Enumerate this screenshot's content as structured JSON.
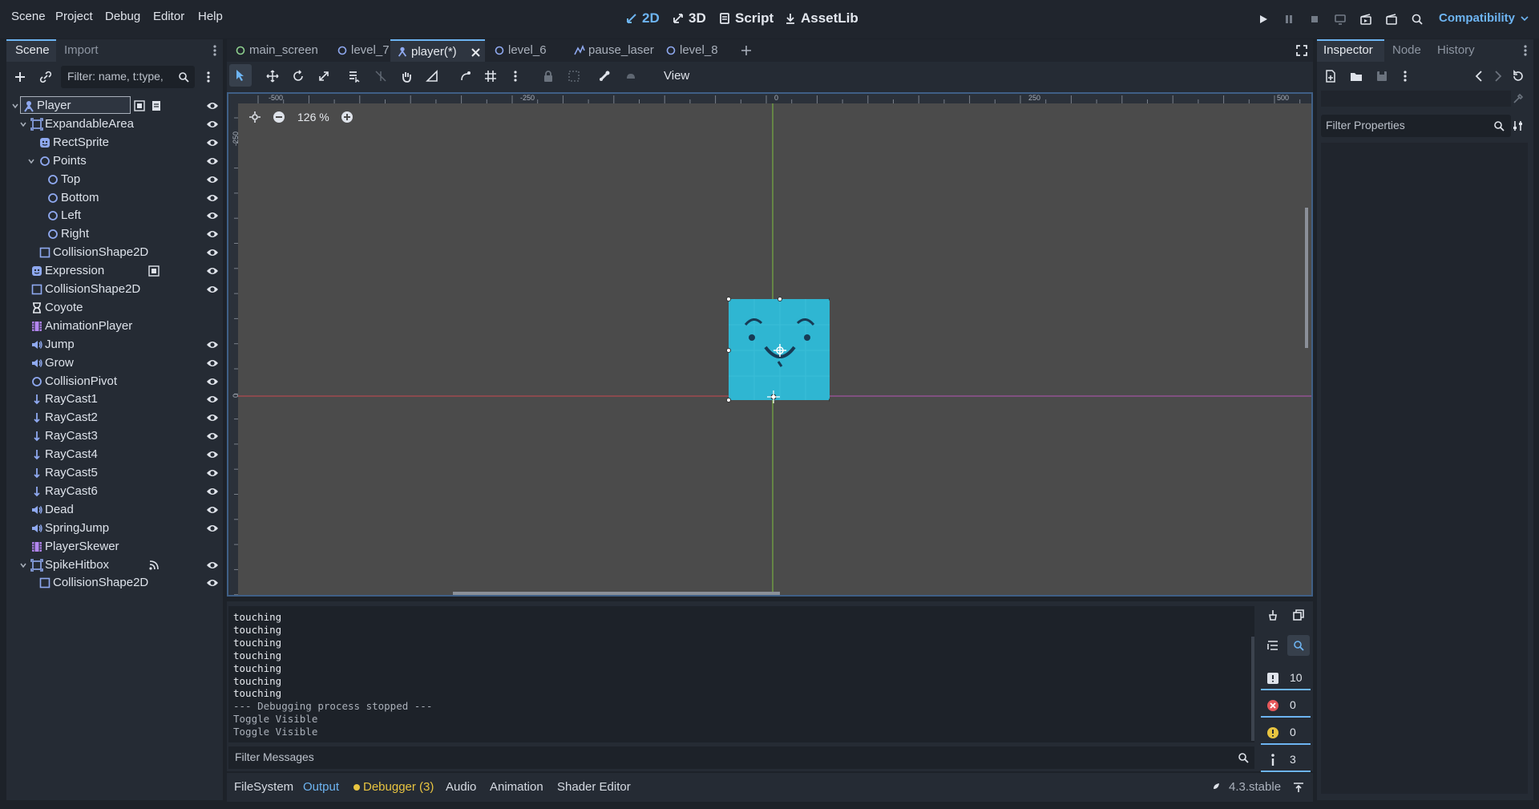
{
  "menubar": {
    "items": [
      "Scene",
      "Project",
      "Debug",
      "Editor",
      "Help"
    ],
    "workspaces": [
      "2D",
      "3D",
      "Script",
      "AssetLib"
    ],
    "active_workspace": "2D",
    "renderer": "Compatibility"
  },
  "scene_dock": {
    "tabs": [
      "Scene",
      "Import"
    ],
    "filter_placeholder": "Filter: name, t:type,",
    "nodes": [
      {
        "name": "Player",
        "icon": "player-node-icon",
        "depth": 0,
        "expanded": true,
        "selected": true
      },
      {
        "name": "ExpandableArea",
        "icon": "area2d-icon",
        "depth": 1,
        "expanded": true
      },
      {
        "name": "RectSprite",
        "icon": "sprite-icon",
        "depth": 2
      },
      {
        "name": "Points",
        "icon": "node2d-icon",
        "depth": 2,
        "expanded": true
      },
      {
        "name": "Top",
        "icon": "node2d-icon",
        "depth": 3
      },
      {
        "name": "Bottom",
        "icon": "node2d-icon",
        "depth": 3
      },
      {
        "name": "Left",
        "icon": "node2d-icon",
        "depth": 3
      },
      {
        "name": "Right",
        "icon": "node2d-icon",
        "depth": 3
      },
      {
        "name": "CollisionShape2D",
        "icon": "collision-shape-icon",
        "depth": 2
      },
      {
        "name": "Expression",
        "icon": "sprite-icon",
        "depth": 1
      },
      {
        "name": "CollisionShape2D",
        "icon": "collision-shape-icon",
        "depth": 1
      },
      {
        "name": "Coyote",
        "icon": "timer-icon",
        "depth": 1
      },
      {
        "name": "AnimationPlayer",
        "icon": "animation-player-icon",
        "depth": 1
      },
      {
        "name": "Jump",
        "icon": "audio-icon",
        "depth": 1
      },
      {
        "name": "Grow",
        "icon": "audio-icon",
        "depth": 1
      },
      {
        "name": "CollisionPivot",
        "icon": "node2d-icon",
        "depth": 1
      },
      {
        "name": "RayCast1",
        "icon": "raycast-icon",
        "depth": 1
      },
      {
        "name": "RayCast2",
        "icon": "raycast-icon",
        "depth": 1
      },
      {
        "name": "RayCast3",
        "icon": "raycast-icon",
        "depth": 1
      },
      {
        "name": "RayCast4",
        "icon": "raycast-icon",
        "depth": 1
      },
      {
        "name": "RayCast5",
        "icon": "raycast-icon",
        "depth": 1
      },
      {
        "name": "RayCast6",
        "icon": "raycast-icon",
        "depth": 1
      },
      {
        "name": "Dead",
        "icon": "audio-icon",
        "depth": 1
      },
      {
        "name": "SpringJump",
        "icon": "audio-icon",
        "depth": 1
      },
      {
        "name": "PlayerSkewer",
        "icon": "animation-player-icon",
        "depth": 1
      },
      {
        "name": "SpikeHitbox",
        "icon": "area2d-icon",
        "depth": 1,
        "expanded": true
      },
      {
        "name": "CollisionShape2D",
        "icon": "collision-shape-icon",
        "depth": 2
      }
    ]
  },
  "editor_tabs": [
    {
      "label": "main_screen",
      "active": false
    },
    {
      "label": "level_7",
      "active": false
    },
    {
      "label": "player(*)",
      "active": true
    },
    {
      "label": "level_6",
      "active": false
    },
    {
      "label": "pause_laser",
      "active": false
    },
    {
      "label": "level_8",
      "active": false
    }
  ],
  "toolbar": {
    "view_label": "View"
  },
  "viewport": {
    "zoom_label": "126 %",
    "ruler_labels": [
      "-500",
      "-250",
      "0",
      "250",
      "500"
    ],
    "ruler_v_labels": [
      "-250",
      "0"
    ],
    "sprite_color": "#2fb6d2"
  },
  "output": {
    "lines": [
      "touching",
      "touching",
      "touching",
      "touching",
      "touching",
      "touching",
      "touching",
      "--- Debugging process stopped ---",
      "Toggle Visible",
      "Toggle Visible"
    ],
    "filter_placeholder": "Filter Messages",
    "counts": {
      "messages": "10",
      "errors": "0",
      "warnings": "0",
      "info": "3"
    }
  },
  "bottom_tabs": [
    "FileSystem",
    "Output",
    "Debugger (3)",
    "Audio",
    "Animation",
    "Shader Editor"
  ],
  "active_bottom_tab": "Output",
  "version": "4.3.stable",
  "inspector": {
    "tabs": [
      "Inspector",
      "Node",
      "History"
    ],
    "filter_placeholder": "Filter Properties"
  },
  "colors": {
    "accent": "#6db4f2",
    "warning": "#e8c440",
    "error": "#e6585b"
  }
}
